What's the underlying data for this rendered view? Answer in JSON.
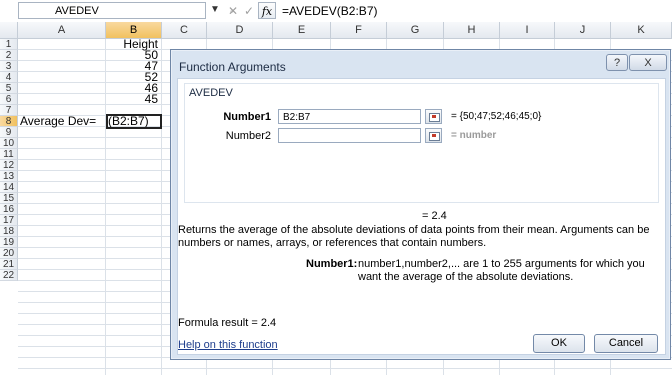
{
  "formula_bar": {
    "name_box": "AVEDEV",
    "cancel_symbol": "✕",
    "enter_symbol": "✓",
    "fx_symbol": "fx",
    "formula": "=AVEDEV(B2:B7)"
  },
  "columns": [
    "A",
    "B",
    "C",
    "D",
    "E",
    "F",
    "G",
    "H",
    "I",
    "J",
    "K"
  ],
  "rows": [
    "1",
    "2",
    "3",
    "4",
    "5",
    "6",
    "7",
    "8",
    "9",
    "10",
    "11",
    "12",
    "13",
    "14",
    "15",
    "16",
    "17",
    "18",
    "19",
    "20",
    "21",
    "22"
  ],
  "cells": {
    "B1": "Height",
    "B2": "50",
    "B3": "47",
    "B4": "52",
    "B5": "46",
    "B6": "45",
    "A8": "Average Dev=",
    "B8": "(B2:B7)"
  },
  "dialog": {
    "title": "Function Arguments",
    "help_symbol": "?",
    "close_symbol": "X",
    "function_name": "AVEDEV",
    "args": [
      {
        "label": "Number1",
        "value": "B2:B7",
        "evaluated": "= {50;47;52;46;45;0}"
      },
      {
        "label": "Number2",
        "value": "",
        "evaluated": "= number"
      }
    ],
    "result_line": "= 2.4",
    "description": "Returns the average of the absolute deviations of data points from their mean. Arguments can be numbers or names, arrays, or references that contain numbers.",
    "arg_desc_label": "Number1:",
    "arg_desc": "number1,number2,... are 1 to 255 arguments for which you want the average of the absolute deviations.",
    "formula_result": "Formula result =  2.4",
    "help_link": "Help on this function",
    "ok_label": "OK",
    "cancel_label": "Cancel"
  },
  "colors": {
    "dialog_bg": "#d9e4f1",
    "selected_header": "#f1c15f",
    "link": "#1d3d8c"
  }
}
